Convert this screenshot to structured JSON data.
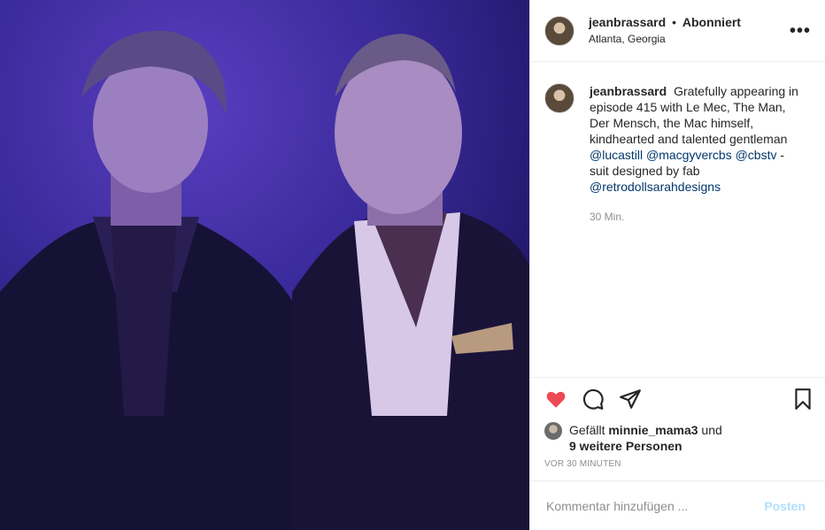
{
  "header": {
    "username": "jeanbrassard",
    "separator": "•",
    "follow_status": "Abonniert",
    "location": "Atlanta, Georgia",
    "more_icon": "ellipsis-icon",
    "more_label": "•••"
  },
  "caption": {
    "username": "jeanbrassard",
    "text_1": "Gratefully appearing in episode 415 with Le Mec, The Man, Der Mensch, the Mac himself, kindhearted and talented gentleman",
    "mention_1": "@lucastill",
    "mention_2": "@macgyvercbs",
    "mention_3": "@cbstv",
    "text_2": "-suit designed by fab",
    "mention_4": "@retrodollsarahdesigns",
    "time": "30 Min."
  },
  "actions": {
    "like_icon": "heart-icon",
    "comment_icon": "comment-icon",
    "share_icon": "share-icon",
    "save_icon": "bookmark-icon",
    "like_color": "#ed4956"
  },
  "likes": {
    "prefix": "Gefällt",
    "user": "minnie_mama3",
    "conj": "und",
    "others": "9 weitere Personen"
  },
  "ago": "VOR 30 MINUTEN",
  "comment": {
    "placeholder": "Kommentar hinzufügen ...",
    "post_label": "Posten"
  }
}
